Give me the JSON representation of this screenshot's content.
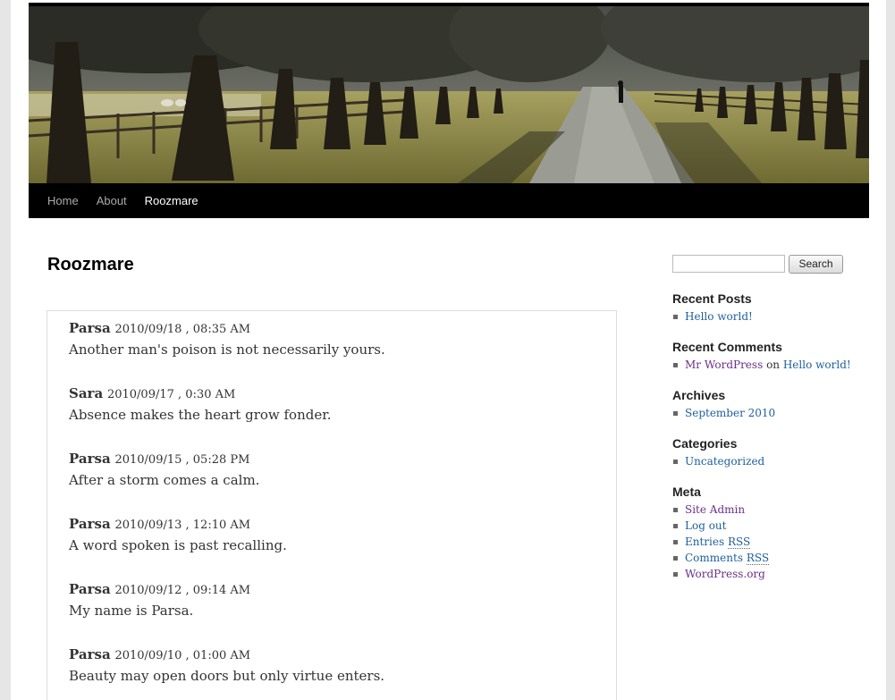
{
  "nav": {
    "items": [
      {
        "label": "Home"
      },
      {
        "label": "About"
      },
      {
        "label": "Roozmare"
      }
    ]
  },
  "page": {
    "title": "Roozmare"
  },
  "entries": [
    {
      "author": "Parsa",
      "date": "2010/09/18 , 08:35 AM",
      "text": "Another man's poison is not necessarily yours."
    },
    {
      "author": "Sara",
      "date": "2010/09/17 , 0:30 AM",
      "text": "Absence makes the heart grow fonder."
    },
    {
      "author": "Parsa",
      "date": "2010/09/15 , 05:28 PM",
      "text": "After a storm comes a calm."
    },
    {
      "author": "Parsa",
      "date": "2010/09/13 , 12:10 AM",
      "text": "A word spoken is past recalling."
    },
    {
      "author": "Parsa",
      "date": "2010/09/12 , 09:14 AM",
      "text": "My name is Parsa."
    },
    {
      "author": "Parsa",
      "date": "2010/09/10 , 01:00 AM",
      "text": "Beauty may open doors but only virtue enters."
    }
  ],
  "sidebar": {
    "search": {
      "button_label": "Search",
      "value": ""
    },
    "recent_posts": {
      "title": "Recent Posts",
      "items": [
        "Hello world!"
      ]
    },
    "recent_comments": {
      "title": "Recent Comments",
      "author": "Mr WordPress",
      "connector": "on",
      "post": "Hello world!"
    },
    "archives": {
      "title": "Archives",
      "items": [
        "September 2010"
      ]
    },
    "categories": {
      "title": "Categories",
      "items": [
        "Uncategorized"
      ]
    },
    "meta": {
      "title": "Meta",
      "site_admin": "Site Admin",
      "log_out": "Log out",
      "entries_prefix": "Entries",
      "comments_prefix": "Comments",
      "rss": "RSS",
      "wordpress_org": "WordPress.org"
    }
  },
  "colors": {
    "link": "#1b5f9e",
    "visited_link": "#6b2f8a",
    "nav_background": "#000000"
  }
}
